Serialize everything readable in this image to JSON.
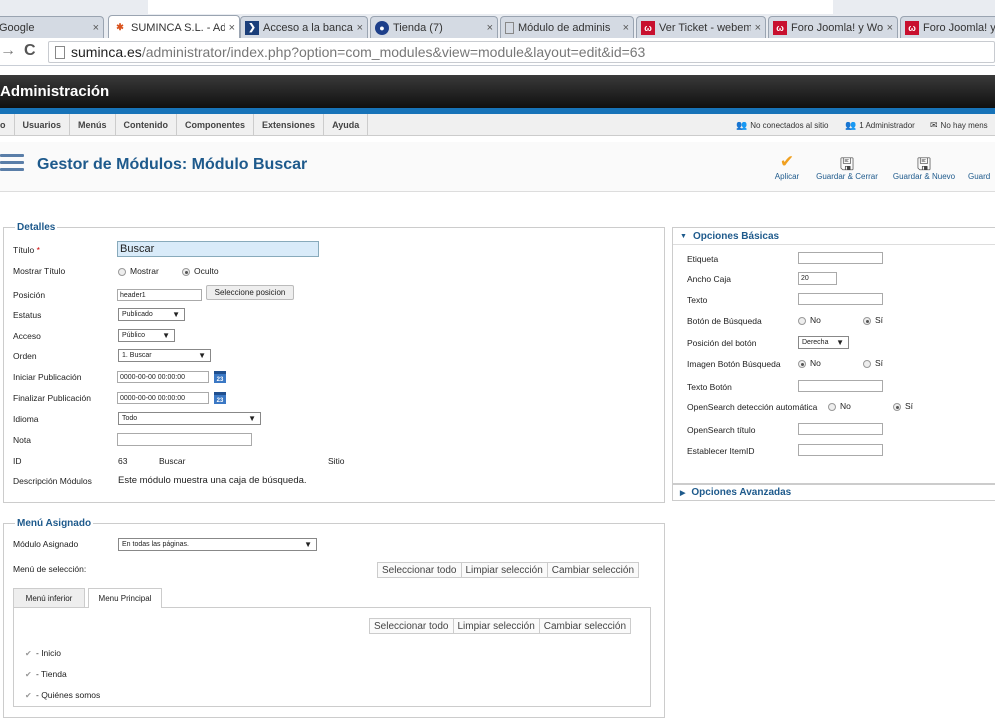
{
  "browser": {
    "tabs": [
      {
        "title": "Google",
        "favicon": "google-icon",
        "active": false
      },
      {
        "title": "SUMINCA S.L. - Adr",
        "favicon": "joomla-icon",
        "active": true
      },
      {
        "title": "Acceso a la banca o",
        "favicon": "bank-icon",
        "active": false
      },
      {
        "title": "Tienda (7)",
        "favicon": "shop-icon",
        "active": false
      },
      {
        "title": "Módulo de adminis",
        "favicon": "page-icon",
        "active": false
      },
      {
        "title": "Ver Ticket - webem",
        "favicon": "webempresa-icon",
        "active": false
      },
      {
        "title": "Foro Joomla! y Wor",
        "favicon": "webempresa-icon",
        "active": false
      },
      {
        "title": "Foro Joomla! y Wo",
        "favicon": "webempresa-icon",
        "active": false
      }
    ],
    "url_host": "suminca.es",
    "url_path": "/administrator/index.php?option=com_modules&view=module&layout=edit&id=63"
  },
  "admin": {
    "title": "Administración",
    "menu": [
      "o",
      "Usuarios",
      "Menús",
      "Contenido",
      "Componentes",
      "Extensiones",
      "Ayuda"
    ],
    "status": {
      "visitors": "No conectados al sitio",
      "admins": "1 Administrador",
      "messages": "No hay mens"
    }
  },
  "toolbar": {
    "title": "Gestor de Módulos: Módulo Buscar",
    "apply": "Aplicar",
    "save_close": "Guardar & Cerrar",
    "save_new": "Guardar & Nuevo",
    "save_copy": "Guard"
  },
  "details": {
    "legend": "Detalles",
    "title_label": "Título",
    "required_mark": "*",
    "title_value": "Buscar",
    "show_title_label": "Mostrar Título",
    "show_option": "Mostrar",
    "hide_option": "Oculto",
    "position_label": "Posición",
    "position_value": "header1",
    "select_position_button": "Seleccione posicion",
    "status_label": "Estatus",
    "status_value": "Publicado",
    "access_label": "Acceso",
    "access_value": "Público",
    "order_label": "Orden",
    "order_value": "1. Buscar",
    "start_label": "Iniciar Publicación",
    "start_value": "0000-00-00 00:00:00",
    "finish_label": "Finalizar Publicación",
    "finish_value": "0000-00-00 00:00:00",
    "calendar_text": "23",
    "language_label": "Idioma",
    "language_value": "Todo",
    "note_label": "Nota",
    "id_label": "ID",
    "id_value": "63",
    "id_name": "Buscar",
    "id_site": "Sitio",
    "desc_label": "Descripción Módulos",
    "desc_value": "Este módulo muestra una caja de búsqueda."
  },
  "menu_assign": {
    "legend": "Menú Asignado",
    "module_assigned_label": "Módulo Asignado",
    "module_assigned_value": "En todas las páginas.",
    "selection_label": "Menú de selección:",
    "select_all": "Seleccionar todo",
    "clear_selection": "Limpiar selección",
    "toggle_selection": "Cambiar selección",
    "tabs": [
      "Menú inferior",
      "Menu Principal"
    ],
    "items": [
      "- Inicio",
      "- Tienda",
      "- Quiénes somos"
    ]
  },
  "basic_options": {
    "heading": "Opciones Básicas",
    "label_label": "Etiqueta",
    "box_width_label": "Ancho Caja",
    "box_width_value": "20",
    "text_label": "Texto",
    "search_button_label": "Botón de Búsqueda",
    "no": "No",
    "yes": "Sí",
    "button_position_label": "Posición del botón",
    "button_position_value": "Derecha",
    "image_button_label": "Imagen Botón Búsqueda",
    "button_text_label": "Texto Botón",
    "opensearch_label": "OpenSearch detección automática",
    "opensearch_title_label": "OpenSearch título",
    "itemid_label": "Establecer ItemID"
  },
  "advanced_options": {
    "heading": "Opciones Avanzadas"
  },
  "colors": {
    "accent": "#1e5a8c",
    "bar": "#1773b8"
  }
}
